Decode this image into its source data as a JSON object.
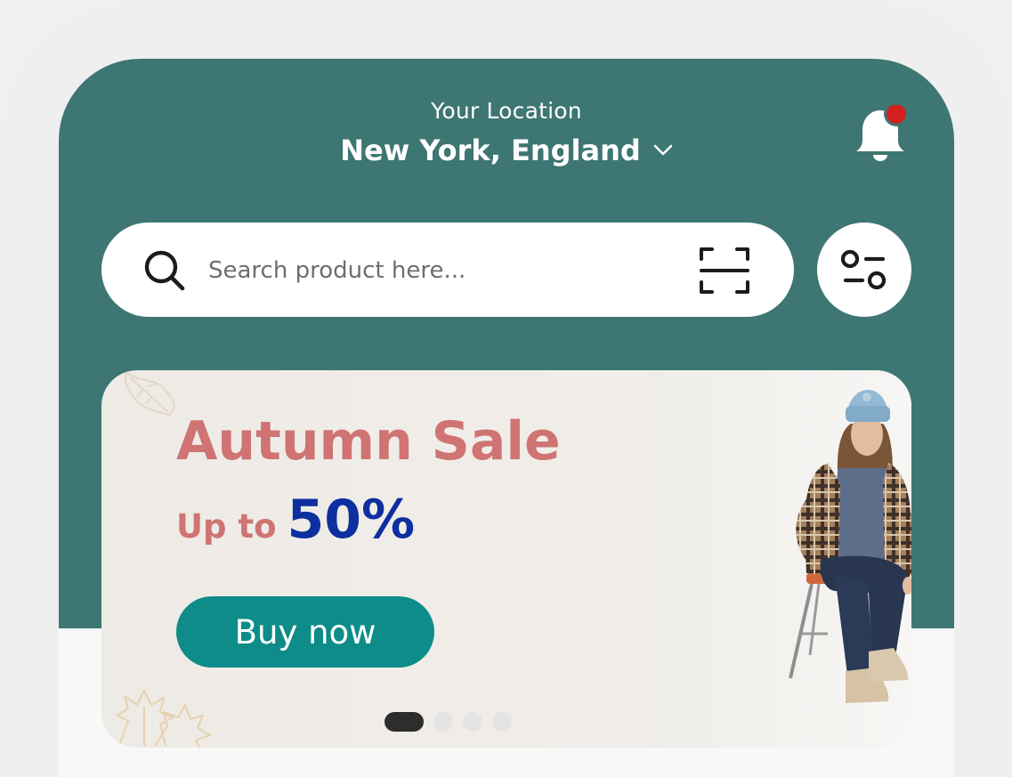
{
  "header": {
    "location_label": "Your Location",
    "location_value": "New York, England",
    "notification_badge": true
  },
  "search": {
    "placeholder": "Search product here..."
  },
  "banner": {
    "title": "Autumn Sale",
    "subtitle_prefix": "Up to",
    "discount": "50%",
    "button_label": "Buy now"
  },
  "carousel": {
    "total_slides": 4,
    "active_index": 0
  },
  "icons": {
    "search": "search-icon",
    "scan": "scan-icon",
    "filter": "filter-icon",
    "notification": "bell-icon",
    "location_dropdown": "chevron-down-icon"
  },
  "colors": {
    "header_bg": "#3d7673",
    "banner_title": "#cf7373",
    "discount": "#0d2fa0",
    "button_bg": "#0e8c89",
    "badge": "#d21f1f"
  }
}
